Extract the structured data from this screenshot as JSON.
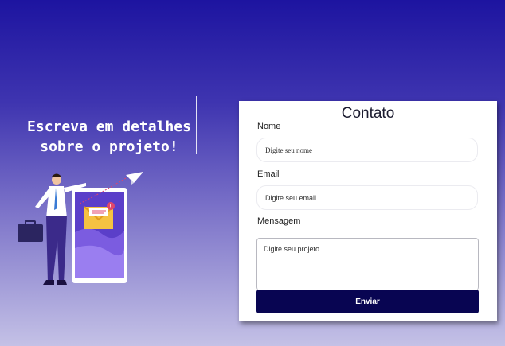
{
  "hero": {
    "tagline_line1": "Escreva em detalhes",
    "tagline_line2": "sobre o projeto!",
    "illustration": "man-sending-email-from-phone-illustration"
  },
  "form": {
    "title": "Contato",
    "name_label": "Nome",
    "name_placeholder": "Digite seu nome",
    "email_label": "Email",
    "email_placeholder": "Digite seu email",
    "message_label": "Mensagem",
    "message_placeholder": "Digite seu projeto",
    "submit_label": "Enviar"
  },
  "colors": {
    "background_top": "#1d14a0",
    "background_bottom": "#c4c1e6",
    "button": "#080552"
  }
}
